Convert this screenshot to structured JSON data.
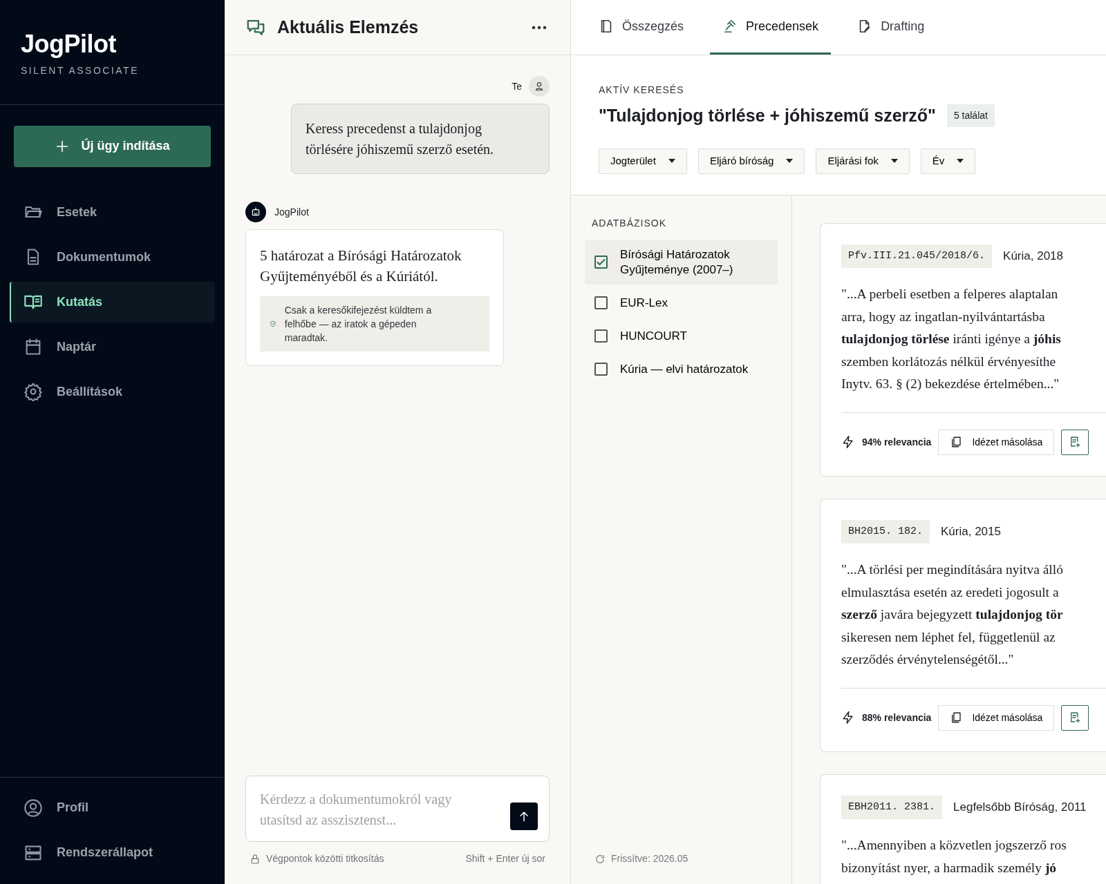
{
  "sidebar": {
    "brand": "JogPilot",
    "tagline": "SILENT ASSOCIATE",
    "new_button": "Új ügy indítása",
    "nav": [
      {
        "label": "Esetek",
        "selected": false
      },
      {
        "label": "Dokumentumok",
        "selected": false
      },
      {
        "label": "Kutatás",
        "selected": true
      },
      {
        "label": "Naptár",
        "selected": false
      },
      {
        "label": "Beállítások",
        "selected": false
      }
    ],
    "footer_nav": [
      {
        "label": "Profil"
      },
      {
        "label": "Rendszerállapot"
      }
    ]
  },
  "chat": {
    "title": "Aktuális Elemzés",
    "messages": [
      {
        "kind": "user",
        "author": "Te",
        "text": "Keress precedenst a tulajdonjog törlésére jóhiszemű szerző esetén."
      },
      {
        "kind": "assistant",
        "author": "JogPilot",
        "text": "5 határozat a Bírósági Határozatok Gyűjteményéből és a Kúriától.",
        "note": "Csak a keresőkifejezést küldtem a felhőbe — az iratok a gépeden maradtak."
      }
    ],
    "input": {
      "placeholder": "Kérdezz a dokumentumokról vagy utasítsd az asszisztenst..."
    },
    "footer": {
      "security": "Végpontok közötti titkosítás",
      "hint": "Shift + Enter új sor"
    }
  },
  "tabs": [
    {
      "label": "Összegzés",
      "selected": false
    },
    {
      "label": "Precedensek",
      "selected": true
    },
    {
      "label": "Drafting",
      "selected": false
    }
  ],
  "search": {
    "label": "AKTÍV KERESÉS",
    "query": "\"Tulajdonjog törlése + jóhiszemű szerző\"",
    "count": "5 találat",
    "filters": [
      "Jogterület",
      "Eljáró bíróság",
      "Eljárási fok",
      "Év"
    ]
  },
  "databases": {
    "heading": "ADATBÁZISOK",
    "items": [
      {
        "label": "Bírósági Határozatok Gyűjteménye (2007–)",
        "checked": true
      },
      {
        "label": "EUR-Lex",
        "checked": false
      },
      {
        "label": "HUNCOURT",
        "checked": false
      },
      {
        "label": "Kúria — elvi határozatok",
        "checked": false
      }
    ],
    "updated": "Frissítve: 2026.05"
  },
  "results": [
    {
      "citation": "Pfv.III.21.045/2018/6.",
      "court": "Kúria, 2018",
      "quote_lines": [
        "\"...A perbeli esetben a felperes alaptalan",
        "arra, hogy az ingatlan-nyilvántartásba",
        "**tulajdonjog törlése** iránti igénye a **jóhis**",
        "szemben korlátozás nélkül érvényesíthe",
        "Inytv. 63. § (2) bekezdése értelmében...\""
      ],
      "relevance": "94% relevancia",
      "copy_label": "Idézet másolása"
    },
    {
      "citation": "BH2015. 182.",
      "court": "Kúria, 2015",
      "quote_lines": [
        "\"...A törlési per megindítására nyitva álló",
        "elmulasztása esetén az eredeti jogosult a",
        "**szerző** javára bejegyzett **tulajdonjog tör**",
        "sikeresen nem léphet fel, függetlenül az",
        "szerződés érvénytelenségétől...\""
      ],
      "relevance": "88% relevancia",
      "copy_label": "Idézet másolása"
    },
    {
      "citation": "EBH2011. 2381.",
      "court": "Legfelsőbb Bíróság, 2011",
      "quote_lines": [
        "\"...Amennyiben a közvetlen jogszerző ros",
        "bizonyítást nyer, a harmadik személy **jó**"
      ]
    }
  ]
}
